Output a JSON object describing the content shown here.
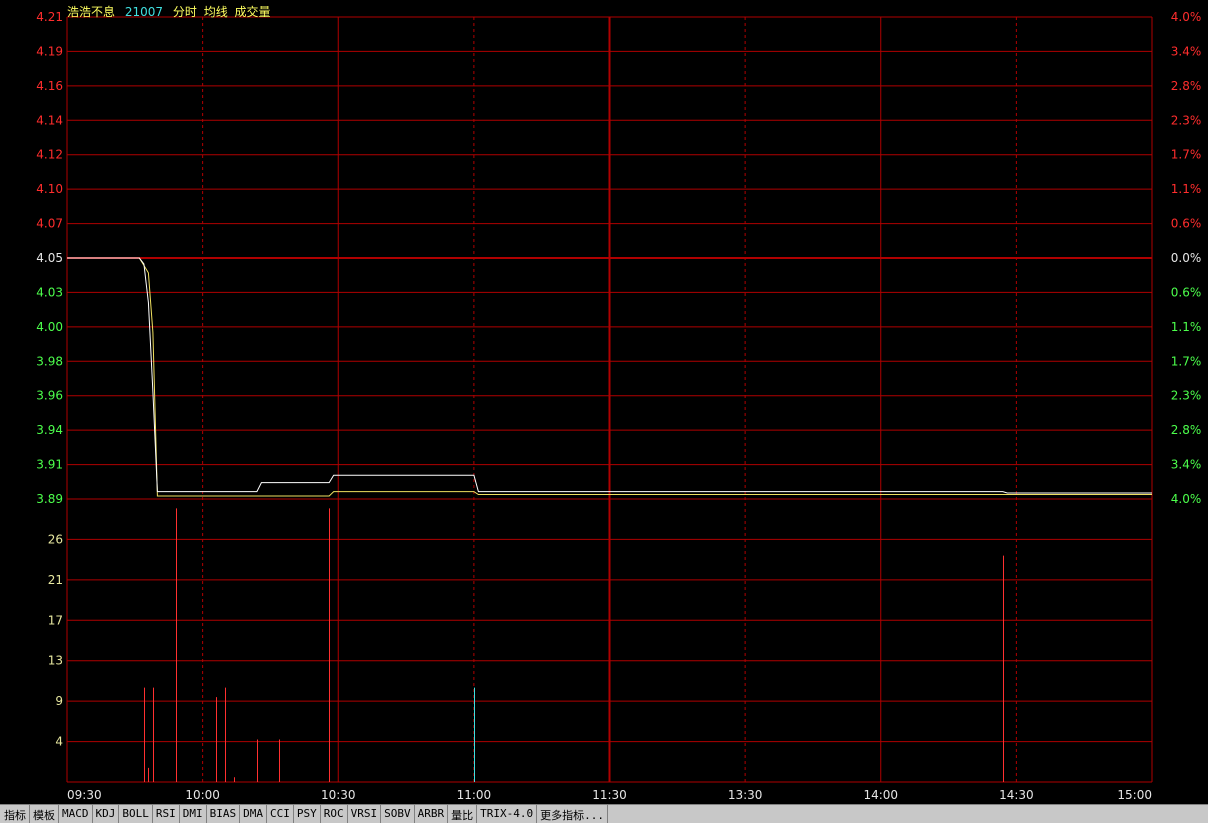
{
  "header": {
    "stock_name": "浩浩不息",
    "stock_code": "21007",
    "chart_label": "分时",
    "avg_label": "均线",
    "volume_label": "成交量"
  },
  "colors": {
    "grid": "#b00000",
    "axis_red": "#ff2d2d",
    "axis_green": "#4cff4c",
    "axis_white": "#e6e6e6",
    "volume_axis": "#e8e8a0",
    "price_line": "#ffffff",
    "avg_line": "#f0e060",
    "vol_up": "#ff3030",
    "vol_down": "#40e0e0",
    "header_name": "#ffff60",
    "header_code": "#40e0e0",
    "header_text": "#ffff60"
  },
  "chart_data": {
    "type": "line",
    "price_axis": {
      "left_labels": [
        "4.21",
        "4.19",
        "4.16",
        "4.14",
        "4.12",
        "4.10",
        "4.07",
        "4.05",
        "4.03",
        "4.00",
        "3.98",
        "3.96",
        "3.94",
        "3.91",
        "3.89"
      ],
      "right_labels": [
        "4.0%",
        "3.4%",
        "2.8%",
        "2.3%",
        "1.7%",
        "1.1%",
        "0.6%",
        "0.0%",
        "0.6%",
        "1.1%",
        "1.7%",
        "2.3%",
        "2.8%",
        "3.4%",
        "4.0%"
      ],
      "ylim": [
        3.888,
        4.212
      ],
      "base_price": 4.05
    },
    "volume_axis": {
      "labels": [
        "26",
        "21",
        "17",
        "13",
        "9",
        "4"
      ],
      "ylim": [
        0,
        30
      ]
    },
    "x_labels": [
      "09:30",
      "10:00",
      "10:30",
      "11:00",
      "11:30",
      "13:30",
      "14:00",
      "14:30",
      "15:00"
    ],
    "price_series": {
      "name": "分时",
      "points": [
        [
          0,
          4.05
        ],
        [
          16,
          4.05
        ],
        [
          17,
          4.046
        ],
        [
          18,
          4.02
        ],
        [
          19,
          3.96
        ],
        [
          20,
          3.893
        ],
        [
          42,
          3.893
        ],
        [
          43,
          3.899
        ],
        [
          58,
          3.899
        ],
        [
          59,
          3.904
        ],
        [
          90,
          3.904
        ],
        [
          91,
          3.893
        ],
        [
          207,
          3.893
        ],
        [
          208,
          3.892
        ],
        [
          240,
          3.892
        ]
      ]
    },
    "avg_series": {
      "name": "均线",
      "points": [
        [
          0,
          4.05
        ],
        [
          16,
          4.05
        ],
        [
          17,
          4.045
        ],
        [
          18,
          4.04
        ],
        [
          19,
          4.0
        ],
        [
          20,
          3.89
        ],
        [
          58,
          3.89
        ],
        [
          59,
          3.893
        ],
        [
          90,
          3.893
        ],
        [
          91,
          3.891
        ],
        [
          240,
          3.891
        ]
      ]
    },
    "volume_bars": [
      {
        "t": 17,
        "v": 10,
        "dir": "up"
      },
      {
        "t": 18,
        "v": 1.5,
        "dir": "up"
      },
      {
        "t": 19,
        "v": 10,
        "dir": "up"
      },
      {
        "t": 24,
        "v": 29,
        "dir": "up"
      },
      {
        "t": 33,
        "v": 9,
        "dir": "up"
      },
      {
        "t": 35,
        "v": 10,
        "dir": "up"
      },
      {
        "t": 37,
        "v": 0.5,
        "dir": "up"
      },
      {
        "t": 42,
        "v": 4.5,
        "dir": "up"
      },
      {
        "t": 47,
        "v": 4.5,
        "dir": "up"
      },
      {
        "t": 58,
        "v": 29,
        "dir": "up"
      },
      {
        "t": 90,
        "v": 10,
        "dir": "down"
      },
      {
        "t": 207,
        "v": 24,
        "dir": "up"
      }
    ]
  },
  "tabs": [
    "指标",
    "模板",
    "MACD",
    "KDJ",
    "BOLL",
    "RSI",
    "DMI",
    "BIAS",
    "DMA",
    "CCI",
    "PSY",
    "ROC",
    "VRSI",
    "SOBV",
    "ARBR",
    "量比",
    "TRIX-4.0",
    "更多指标..."
  ]
}
